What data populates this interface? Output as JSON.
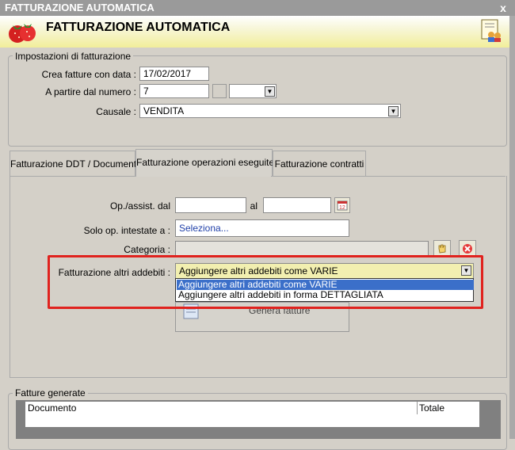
{
  "window": {
    "title": "FATTURAZIONE AUTOMATICA",
    "close_label": "x"
  },
  "header": {
    "title": "FATTURAZIONE AUTOMATICA"
  },
  "settings": {
    "group_label": "Impostazioni di fatturazione",
    "date_label": "Crea fatture con data :",
    "date_value": "17/02/2017",
    "number_label": "A partire dal numero :",
    "number_value": "7",
    "causale_label": "Causale :",
    "causale_value": "VENDITA"
  },
  "tabs": [
    {
      "label": "Fatturazione DDT / Documenti"
    },
    {
      "label": "Fatturazione operazioni eseguite"
    },
    {
      "label": "Fatturazione contratti"
    }
  ],
  "panel": {
    "op_dal_label": "Op./assist. dal",
    "al_label": "al",
    "solo_op_label": "Solo op. intestate a :",
    "solo_op_value": "Seleziona...",
    "categoria_label": "Categoria :",
    "altri_addebiti_label": "Fatturazione altri addebiti :",
    "altri_addebiti_value": "Aggiungere altri addebiti come VARIE",
    "options": [
      "Aggiungere altri addebiti come VARIE",
      "Aggiungere altri addebiti in forma DETTAGLIATA"
    ],
    "generate_label": "Genera fatture"
  },
  "generated": {
    "group_label": "Fatture generate",
    "columns": [
      "Documento",
      "Totale"
    ]
  },
  "colors": {
    "highlight_border": "#e0221e",
    "selection": "#3b6fc9"
  }
}
